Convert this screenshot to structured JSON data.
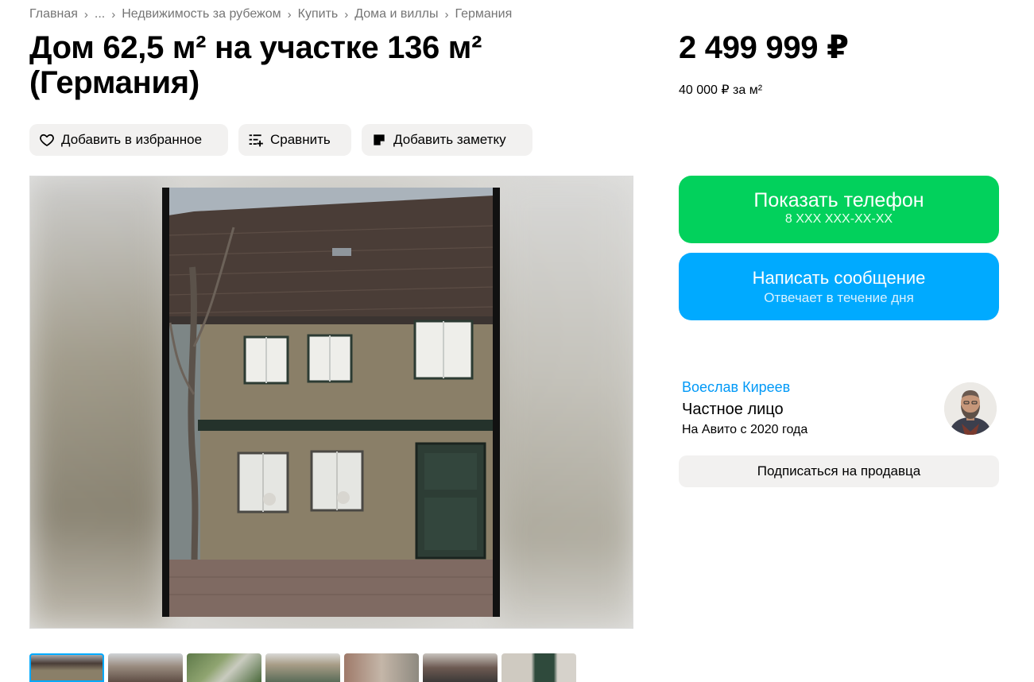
{
  "breadcrumb": {
    "items": [
      "Главная",
      "...",
      "Недвижимость за рубежом",
      "Купить",
      "Дома и виллы",
      "Германия"
    ],
    "separator": "›"
  },
  "listing": {
    "title": "Дом 62,5 м² на участке 136 м² (Германия)",
    "price": "2 499 999 ₽",
    "price_per_m2": "40 000 ₽ за м²"
  },
  "actions": {
    "favorite": "Добавить в избранное",
    "compare": "Сравнить",
    "note": "Добавить заметку"
  },
  "contact": {
    "phone_label": "Показать телефон",
    "phone_masked": "8 XXX XXX-XX-XX",
    "message_label": "Написать сообщение",
    "message_sub": "Отвечает в течение дня"
  },
  "seller": {
    "name": "Воеслав Киреев",
    "type": "Частное лицо",
    "since": "На Авито с 2020 года",
    "subscribe": "Подписаться на продавца"
  },
  "gallery": {
    "thumbnail_count": 7,
    "active_index": 0
  },
  "icons": {
    "favorite": "heart-icon",
    "compare": "compare-list-icon",
    "note": "note-icon",
    "breadcrumb_separator": "chevron-right-icon"
  },
  "colors": {
    "phone_button": "#02d15c",
    "message_button": "#00aaff",
    "seller_link": "#0099f7",
    "secondary_button": "#f2f1f0",
    "thumbnail_active": "#00aaff"
  }
}
